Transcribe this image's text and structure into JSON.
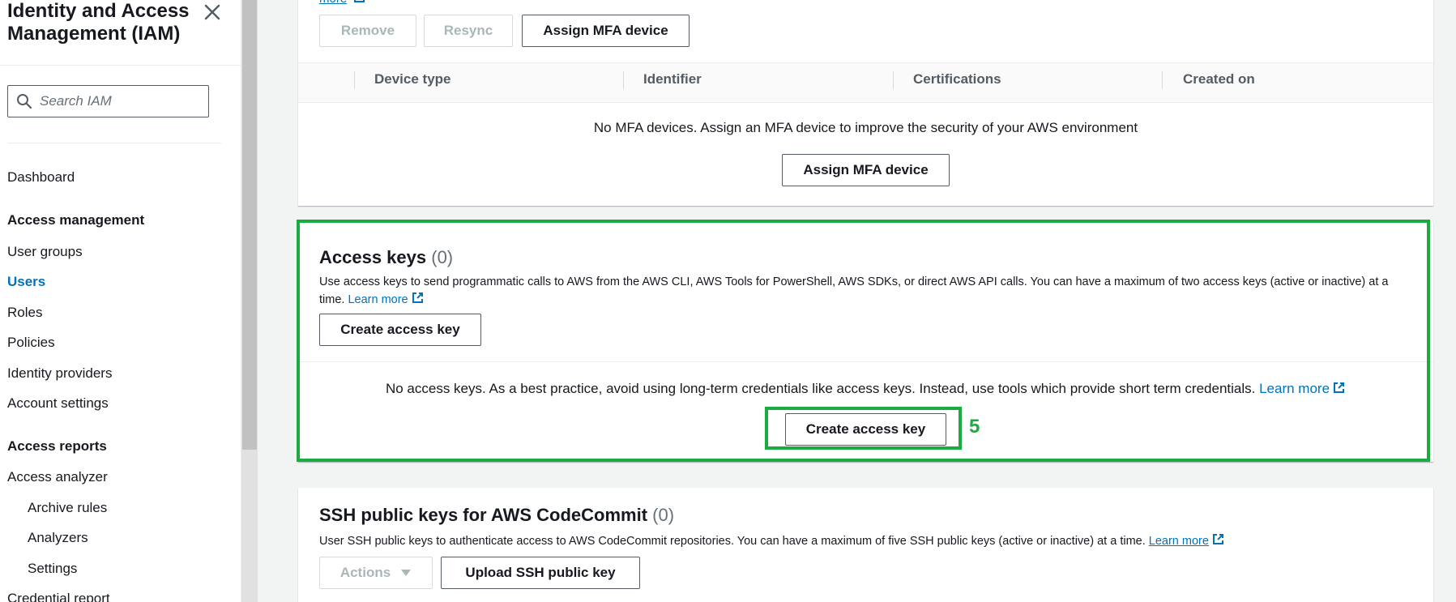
{
  "sidebar": {
    "title": "Identity and Access Management (IAM)",
    "search_placeholder": "Search IAM",
    "items": {
      "dashboard": "Dashboard",
      "access_management": "Access management",
      "user_groups": "User groups",
      "users": "Users",
      "roles": "Roles",
      "policies": "Policies",
      "identity_providers": "Identity providers",
      "account_settings": "Account settings",
      "access_reports": "Access reports",
      "access_analyzer": "Access analyzer",
      "archive_rules": "Archive rules",
      "analyzers": "Analyzers",
      "settings": "Settings",
      "credential_report": "Credential report"
    }
  },
  "mfa": {
    "top_link": "more",
    "remove_label": "Remove",
    "resync_label": "Resync",
    "assign_label": "Assign MFA device",
    "columns": [
      "Device type",
      "Identifier",
      "Certifications",
      "Created on"
    ],
    "empty_text": "No MFA devices. Assign an MFA device to improve the security of your AWS environment",
    "empty_assign_label": "Assign MFA device"
  },
  "access_keys": {
    "title": "Access keys",
    "count": "(0)",
    "description": "Use access keys to send programmatic calls to AWS from the AWS CLI, AWS Tools for PowerShell, AWS SDKs, or direct AWS API calls. You can have a maximum of two access keys (active or inactive) at a time.",
    "learn_more": "Learn more",
    "create_label": "Create access key",
    "empty_text": "No access keys. As a best practice, avoid using long-term credentials like access keys. Instead, use tools which provide short term credentials.",
    "empty_learn_more": "Learn more",
    "empty_create_label": "Create access key"
  },
  "ssh_keys": {
    "title": "SSH public keys for AWS CodeCommit",
    "count": "(0)",
    "description": "User SSH public keys to authenticate access to AWS CodeCommit repositories. You can have a maximum of five SSH public keys (active or inactive) at a time.",
    "learn_more": "Learn more",
    "actions_label": "Actions",
    "upload_label": "Upload SSH public key"
  },
  "annotation": {
    "step_number": "5",
    "color": "#1aac41"
  },
  "colors": {
    "link": "#0073bb",
    "text": "#16191f",
    "muted": "#687078",
    "background": "#f2f3f3"
  }
}
